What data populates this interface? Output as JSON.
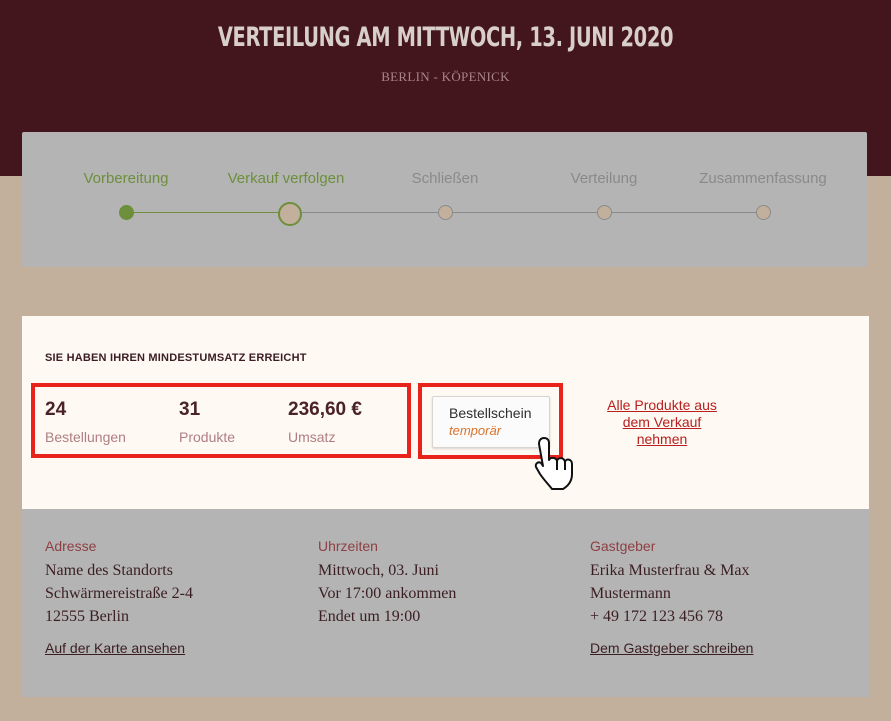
{
  "header": {
    "title": "VERTEILUNG AM MITTWOCH, 13. JUNI 2020",
    "subtitle": "BERLIN - KÖPENICK"
  },
  "stepper": {
    "steps": [
      {
        "label": "Vorbereitung",
        "state": "done"
      },
      {
        "label": "Verkauf verfolgen",
        "state": "current"
      },
      {
        "label": "Schließen",
        "state": "todo"
      },
      {
        "label": "Verteilung",
        "state": "todo"
      },
      {
        "label": "Zusammenfassung",
        "state": "todo"
      }
    ]
  },
  "summary": {
    "heading": "SIE HABEN IHREN MINDESTUMSATZ ERREICHT",
    "stats": [
      {
        "value": "24",
        "label": "Bestellungen"
      },
      {
        "value": "31",
        "label": "Produkte"
      },
      {
        "value": "236,60 €",
        "label": "Umsatz"
      }
    ],
    "order_button": {
      "label": "Bestellschein",
      "sublabel": "temporär"
    },
    "remove_link": "Alle Produkte aus dem Verkauf nehmen"
  },
  "info": {
    "address": {
      "label": "Adresse",
      "lines": [
        "Name des Standorts",
        "Schwärmereistraße 2-4",
        "12555 Berlin"
      ],
      "link": "Auf der Karte ansehen"
    },
    "times": {
      "label": "Uhrzeiten",
      "lines": [
        "Mittwoch, 03. Juni",
        "Vor 17:00 ankommen",
        "Endet um 19:00"
      ]
    },
    "host": {
      "label": "Gastgeber",
      "lines": [
        "Erika Musterfrau & Max",
        "Mustermann",
        "+ 49 172 123 456 78"
      ],
      "link": "Dem Gastgeber schreiben"
    }
  },
  "colors": {
    "header_bg": "#43161d",
    "page_bg": "#c2b09c",
    "accent_green": "#6d8f3c",
    "highlight_red": "#e8231c",
    "link_red": "#b91f1f",
    "temp_orange": "#d9732c"
  },
  "icons": {
    "cursor": "pointing-hand-icon"
  }
}
